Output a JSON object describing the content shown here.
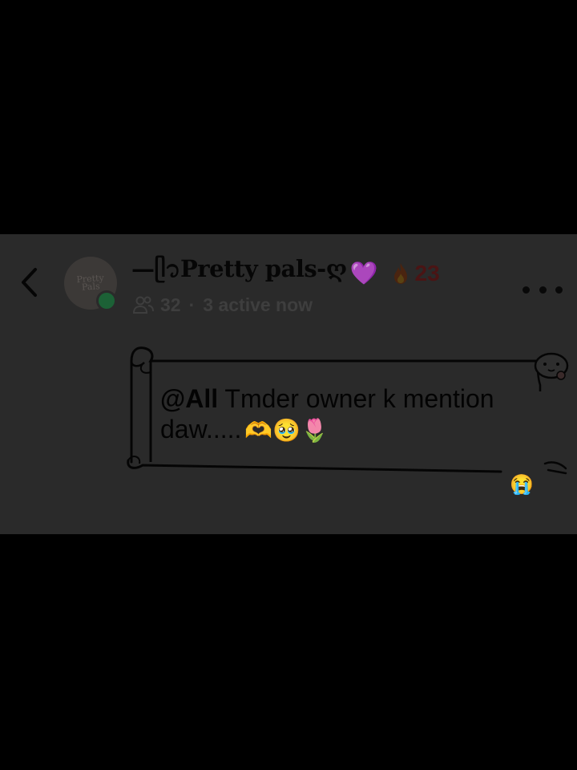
{
  "header": {
    "back_icon": "chevron-left-icon",
    "avatar_text": "Pretty Pals",
    "group_name": "—ᥫ᭡Pretty pals-ღ",
    "heart_emoji": "💜",
    "streak_emoji": "🔥",
    "streak_count": "23",
    "members_icon": "people-icon",
    "members_count": "32",
    "separator": "·",
    "active_text": "3 active now",
    "more_icon": "more-dots-icon"
  },
  "message": {
    "mention": "@All",
    "text": " Tmder owner k mention daw.....",
    "emojis": "🫶🥹🌷",
    "reaction": "😭"
  },
  "colors": {
    "background": "#000000",
    "panel": "#2a2a2a",
    "online": "#1c6136"
  }
}
